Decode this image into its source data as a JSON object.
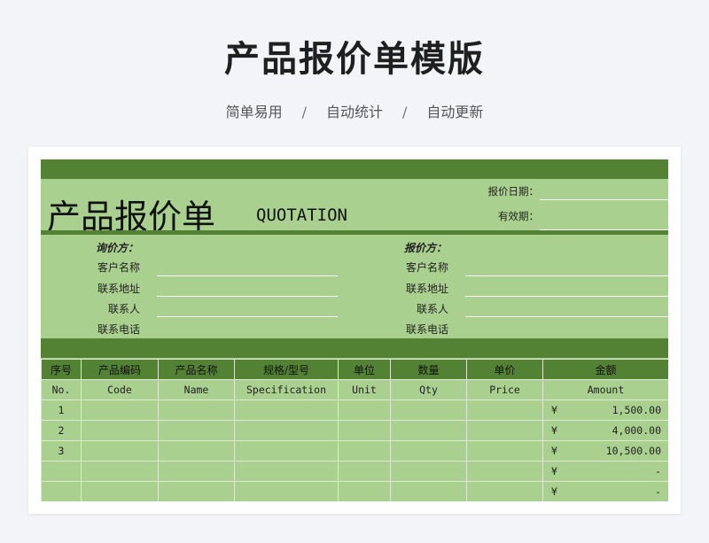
{
  "page": {
    "title": "产品报价单模版",
    "tags": [
      "简单易用",
      "自动统计",
      "自动更新"
    ],
    "separator": "/"
  },
  "sheet": {
    "title_cn": "产品报价单",
    "title_en": "QUOTATION",
    "quote_date_label": "报价日期：",
    "valid_label": "有效期：",
    "inquirer": {
      "title": "询价方：",
      "fields": [
        "客户名称",
        "联系地址",
        "联系人",
        "联系电话"
      ]
    },
    "quoter": {
      "title": "报价方：",
      "fields": [
        "客户名称",
        "联系地址",
        "联系人",
        "联系电话"
      ]
    },
    "table": {
      "headers_cn": [
        "序号",
        "产品编码",
        "产品名称",
        "规格/型号",
        "单位",
        "数量",
        "单价",
        "金额"
      ],
      "headers_en": [
        "No.",
        "Code",
        "Name",
        "Specification",
        "Unit",
        "Qty",
        "Price",
        "Amount"
      ],
      "rows": [
        {
          "no": "1",
          "currency": "¥",
          "amount": "1,500.00"
        },
        {
          "no": "2",
          "currency": "¥",
          "amount": "4,000.00"
        },
        {
          "no": "3",
          "currency": "¥",
          "amount": "10,500.00"
        },
        {
          "no": "",
          "currency": "¥",
          "amount": "-"
        },
        {
          "no": "",
          "currency": "¥",
          "amount": "-"
        }
      ]
    }
  },
  "colors": {
    "sheet_bg": "#a9d08e",
    "band": "#548235"
  }
}
